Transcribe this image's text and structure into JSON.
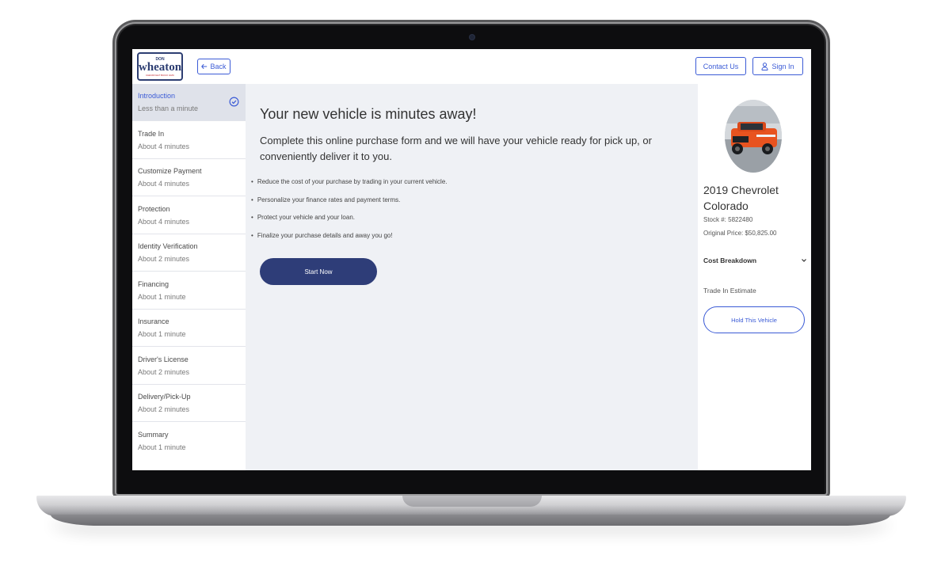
{
  "header": {
    "logo": {
      "small": "DON",
      "main": "wheaton",
      "tagline": "CHEVROLET BUICK GMC"
    },
    "back_label": "Back",
    "contact_label": "Contact Us",
    "signin_label": "Sign In"
  },
  "sidebar": {
    "items": [
      {
        "title": "Introduction",
        "time": "Less than a minute",
        "active": true
      },
      {
        "title": "Trade In",
        "time": "About 4 minutes"
      },
      {
        "title": "Customize Payment",
        "time": "About 4 minutes"
      },
      {
        "title": "Protection",
        "time": "About 4 minutes"
      },
      {
        "title": "Identity Verification",
        "time": "About 2 minutes"
      },
      {
        "title": "Financing",
        "time": "About 1 minute"
      },
      {
        "title": "Insurance",
        "time": "About 1 minute"
      },
      {
        "title": "Driver's License",
        "time": "About 2 minutes"
      },
      {
        "title": "Delivery/Pick-Up",
        "time": "About 2 minutes"
      },
      {
        "title": "Summary",
        "time": "About 1 minute"
      }
    ]
  },
  "main": {
    "headline": "Your new vehicle is minutes away!",
    "subhead": "Complete this online purchase form and we will have your vehicle ready for pick up, or conveniently deliver it to you.",
    "bullets": [
      "Reduce the cost of your purchase by trading in your current vehicle.",
      "Personalize your finance rates and payment terms.",
      "Protect your vehicle and your loan.",
      "Finalize your purchase details and away you go!"
    ],
    "start_label": "Start Now"
  },
  "vehicle": {
    "name": "2019 Chevrolet Colorado",
    "stock": "Stock #: 5822480",
    "original_price": "Original Price: $50,825.00",
    "cost_breakdown_label": "Cost Breakdown",
    "trade_in_label": "Trade In Estimate",
    "hold_label": "Hold This Vehicle"
  },
  "colors": {
    "accent": "#3b5bd6",
    "primary_button": "#2e3d78",
    "main_bg": "#eff1f5",
    "active_step_bg": "#dfe2ea"
  },
  "icons": [
    "back-arrow-icon",
    "user-icon",
    "check-circle-icon",
    "chevron-down-icon",
    "camera-icon"
  ]
}
